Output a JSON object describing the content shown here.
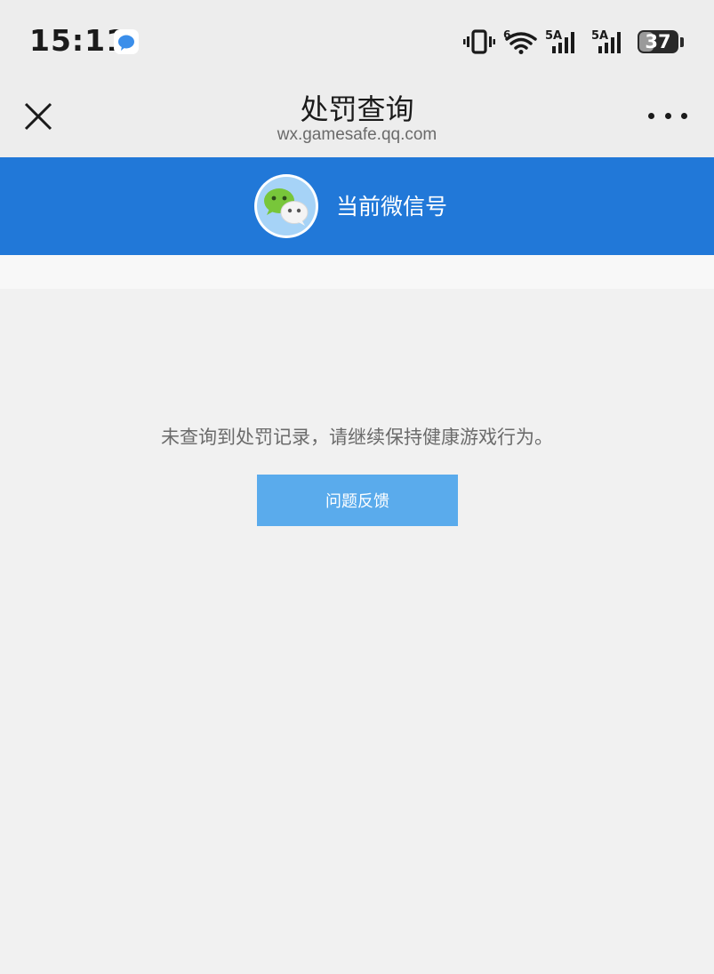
{
  "status_bar": {
    "time": "15:11",
    "notification_icon": "chat-bubble-icon",
    "wifi_label": "6",
    "signal1_label": "5A",
    "signal2_label": "5A",
    "battery_level": "37"
  },
  "title_bar": {
    "close_icon": "close-icon",
    "title": "处罚查询",
    "url": "wx.gamesafe.qq.com",
    "more_icon": "more-icon"
  },
  "account": {
    "avatar_icon": "wechat-logo-icon",
    "label": "当前微信号"
  },
  "main": {
    "result_text": "未查询到处罚记录，请继续保持健康游戏行为。",
    "feedback_button": "问题反馈"
  },
  "colors": {
    "header_blue": "#2178d8",
    "button_blue": "#5aabec",
    "background": "#f1f1f1"
  }
}
